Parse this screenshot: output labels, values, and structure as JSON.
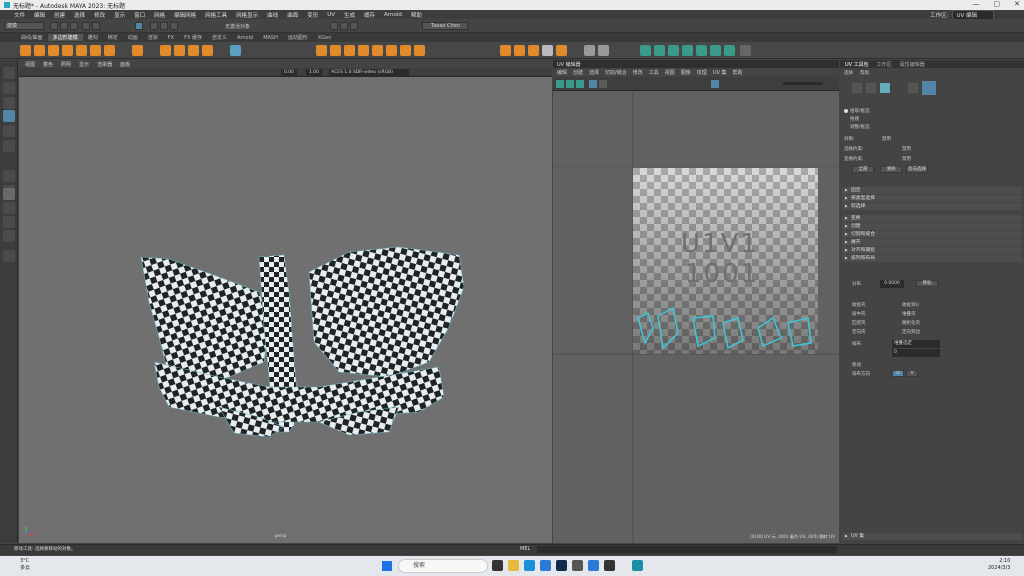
{
  "window": {
    "title": "无标题* - Autodesk MAYA 2023: 无标题",
    "controls": [
      "—",
      "▢",
      "✕"
    ]
  },
  "menubar": {
    "items": [
      "文件",
      "编辑",
      "创建",
      "选择",
      "修改",
      "显示",
      "窗口",
      "网格",
      "编辑网格",
      "网格工具",
      "网格显示",
      "曲线",
      "曲面",
      "变形",
      "UV",
      "生成",
      "缓存",
      "Arnold",
      "帮助"
    ],
    "workspace_label": "工作区:",
    "workspace_value": "UV 编辑"
  },
  "statusline": {
    "mode": "建模",
    "snap_label": "无激活对象",
    "user": "Taoao Chen"
  },
  "shelf_tabs": {
    "items": [
      "曲线/曲面",
      "多边形建模",
      "雕刻",
      "绑定",
      "动画",
      "渲染",
      "FX",
      "FX 缓存",
      "自定义",
      "Arnold",
      "MASH",
      "运动图形",
      "XGen"
    ],
    "active": 1
  },
  "viewport": {
    "menu": [
      "视图",
      "着色",
      "照明",
      "显示",
      "渲染器",
      "面板"
    ],
    "exposure": "0.00",
    "gamma": "1.00",
    "colorspace": "ACES 1.0 SDR-video (sRGB)",
    "camera_label": "persp"
  },
  "uv_editor": {
    "title": "UV 编辑器",
    "menu": [
      "编辑",
      "创建",
      "选择",
      "切割/缝合",
      "修改",
      "工具",
      "视图",
      "图像",
      "纹理",
      "UV 集",
      "帮助"
    ],
    "tile_label_1": "U1V1",
    "tile_label_2": "1001",
    "status": "(0/10) UV 元, (0/0) 着色 UV, (0/0) 翻转 UV"
  },
  "right_panel": {
    "tabs": [
      "UV 工具包",
      "工作区",
      "属性编辑器"
    ],
    "menu": [
      "选择",
      "帮助"
    ],
    "radio": [
      "拾取/框选",
      "拖拽",
      "调整/框选"
    ],
    "field_rows": [
      {
        "label": "对称:",
        "value": "禁用"
      },
      {
        "label": "选择约束:",
        "value": "禁用"
      },
      {
        "label": "变换约束:",
        "value": "禁用"
      }
    ],
    "buttons": [
      "全部",
      "清除",
      "反向选择"
    ],
    "sections": [
      "固定",
      "按类型选择",
      "软选择",
      "变换",
      "创建",
      "切割和缝合",
      "展开",
      "对齐和捕捉",
      "排列和布局"
    ],
    "distribute_label": "分布",
    "distribute_value": "0.0000",
    "distribute_btn": "目标",
    "layout_buttons": [
      "收拢壳",
      "收拢到U",
      "居中壳",
      "堆叠壳",
      "匹配壳",
      "随机化壳",
      "定向壳",
      "定向到边"
    ],
    "layout_label": "排布",
    "layout_value": "堆叠选定",
    "layout_num": "0",
    "check_label_1": "移动",
    "check_label_2": "排布方向",
    "u_btn": "U",
    "v_btn": "V",
    "uvset_section": "UV 集"
  },
  "commandline": {
    "help": "移动工具: 选择要移动的对象。",
    "mel": "MEL"
  },
  "taskbar": {
    "weather_temp": "3°C",
    "weather_desc": "多云",
    "search": "搜索",
    "time": "2:10",
    "date": "2024/3/3"
  }
}
